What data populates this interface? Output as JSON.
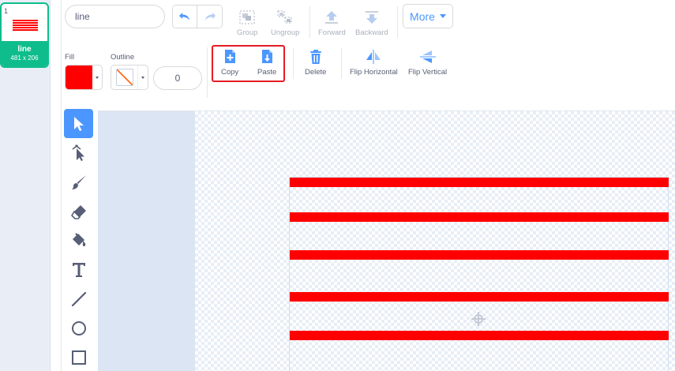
{
  "costume": {
    "number": "1",
    "name": "line",
    "size": "481 x 206"
  },
  "toolbar": {
    "costume_name_value": "line",
    "group_label": "Group",
    "ungroup_label": "Ungroup",
    "forward_label": "Forward",
    "backward_label": "Backward",
    "more_label": "More",
    "fill_label": "Fill",
    "outline_label": "Outline",
    "outline_width_value": "0",
    "copy_label": "Copy",
    "paste_label": "Paste",
    "delete_label": "Delete",
    "flip_horizontal_label": "Flip Horizontal",
    "flip_vertical_label": "Flip Vertical"
  },
  "colors": {
    "fill": "#ff0000",
    "accent": "#4c97ff",
    "costume_selected": "#0fbd8c",
    "highlight": "#e51c23"
  },
  "tools": [
    "select-tool",
    "reshape-tool",
    "brush-tool",
    "eraser-tool",
    "fill-tool",
    "text-tool",
    "line-tool",
    "circle-tool",
    "rectangle-tool"
  ],
  "canvas": {
    "line_count": 5,
    "line_color": "#ff0000"
  }
}
